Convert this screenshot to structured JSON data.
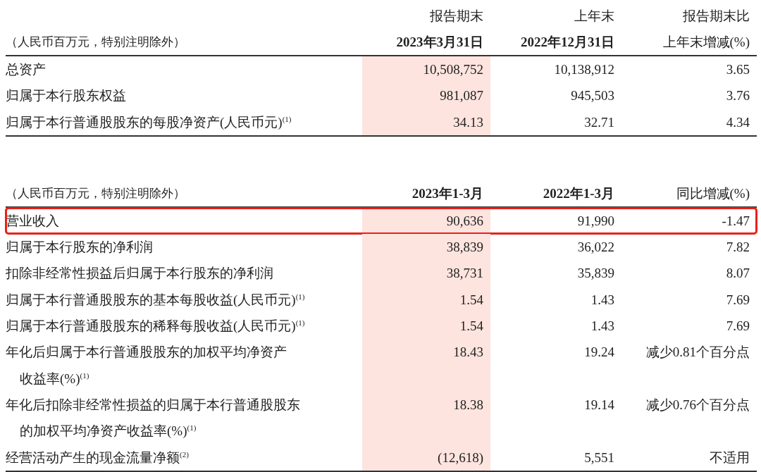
{
  "tables": [
    {
      "unit_note": "（人民币百万元，特别注明除外）",
      "columns": [
        {
          "shaded": true,
          "header": [
            {
              "text": "报告期末",
              "bold": false
            },
            {
              "text": "2023年3月31日",
              "bold": true
            }
          ]
        },
        {
          "shaded": false,
          "header": [
            {
              "text": "上年末",
              "bold": false
            },
            {
              "text": "2022年12月31日",
              "bold": true
            }
          ]
        },
        {
          "shaded": false,
          "header": [
            {
              "text": "报告期末比",
              "bold": false
            },
            {
              "text": "上年末增减(%)",
              "bold": false
            }
          ]
        }
      ],
      "rows": [
        {
          "label": [
            "总资产"
          ],
          "values": [
            "10,508,752",
            "10,138,912",
            "3.65"
          ],
          "highlighted": false
        },
        {
          "label": [
            "归属于本行股东权益"
          ],
          "values": [
            "981,087",
            "945,503",
            "3.76"
          ],
          "highlighted": false
        },
        {
          "label": [
            "归属于本行普通股股东的每股净资产(人民币元)$^{(1)}$"
          ],
          "values": [
            "34.13",
            "32.71",
            "4.34"
          ],
          "highlighted": false
        }
      ]
    },
    {
      "unit_note": "（人民币百万元，特别注明除外）",
      "columns": [
        {
          "shaded": true,
          "header": [
            {
              "text": "2023年1-3月",
              "bold": true
            }
          ]
        },
        {
          "shaded": false,
          "header": [
            {
              "text": "2022年1-3月",
              "bold": true
            }
          ]
        },
        {
          "shaded": false,
          "header": [
            {
              "text": "同比增减(%)",
              "bold": false
            }
          ]
        }
      ],
      "rows": [
        {
          "label": [
            "营业收入"
          ],
          "values": [
            "90,636",
            "91,990",
            "-1.47"
          ],
          "highlighted": true
        },
        {
          "label": [
            "归属于本行股东的净利润"
          ],
          "values": [
            "38,839",
            "36,022",
            "7.82"
          ],
          "highlighted": false
        },
        {
          "label": [
            "扣除非经常性损益后归属于本行股东的净利润"
          ],
          "values": [
            "38,731",
            "35,839",
            "8.07"
          ],
          "highlighted": false
        },
        {
          "label": [
            "归属于本行普通股股东的基本每股收益(人民币元)$^{(1)}$"
          ],
          "values": [
            "1.54",
            "1.43",
            "7.69"
          ],
          "highlighted": false
        },
        {
          "label": [
            "归属于本行普通股股东的稀释每股收益(人民币元)$^{(1)}$"
          ],
          "values": [
            "1.54",
            "1.43",
            "7.69"
          ],
          "highlighted": false
        },
        {
          "label": [
            "年化后归属于本行普通股股东的加权平均净资产",
            "收益率(%)$^{(1)}$"
          ],
          "values": [
            "18.43",
            "19.24",
            "减少0.81个百分点"
          ],
          "highlighted": false
        },
        {
          "label": [
            "年化后扣除非经常性损益的归属于本行普通股股东",
            "的加权平均净资产收益率(%)$^{(1)}$"
          ],
          "values": [
            "18.38",
            "19.14",
            "减少0.76个百分点"
          ],
          "highlighted": false
        },
        {
          "label": [
            "经营活动产生的现金流量净额$^{(2)}$"
          ],
          "values": [
            "(12,618)",
            "5,551",
            "不适用"
          ],
          "highlighted": false
        }
      ]
    }
  ]
}
